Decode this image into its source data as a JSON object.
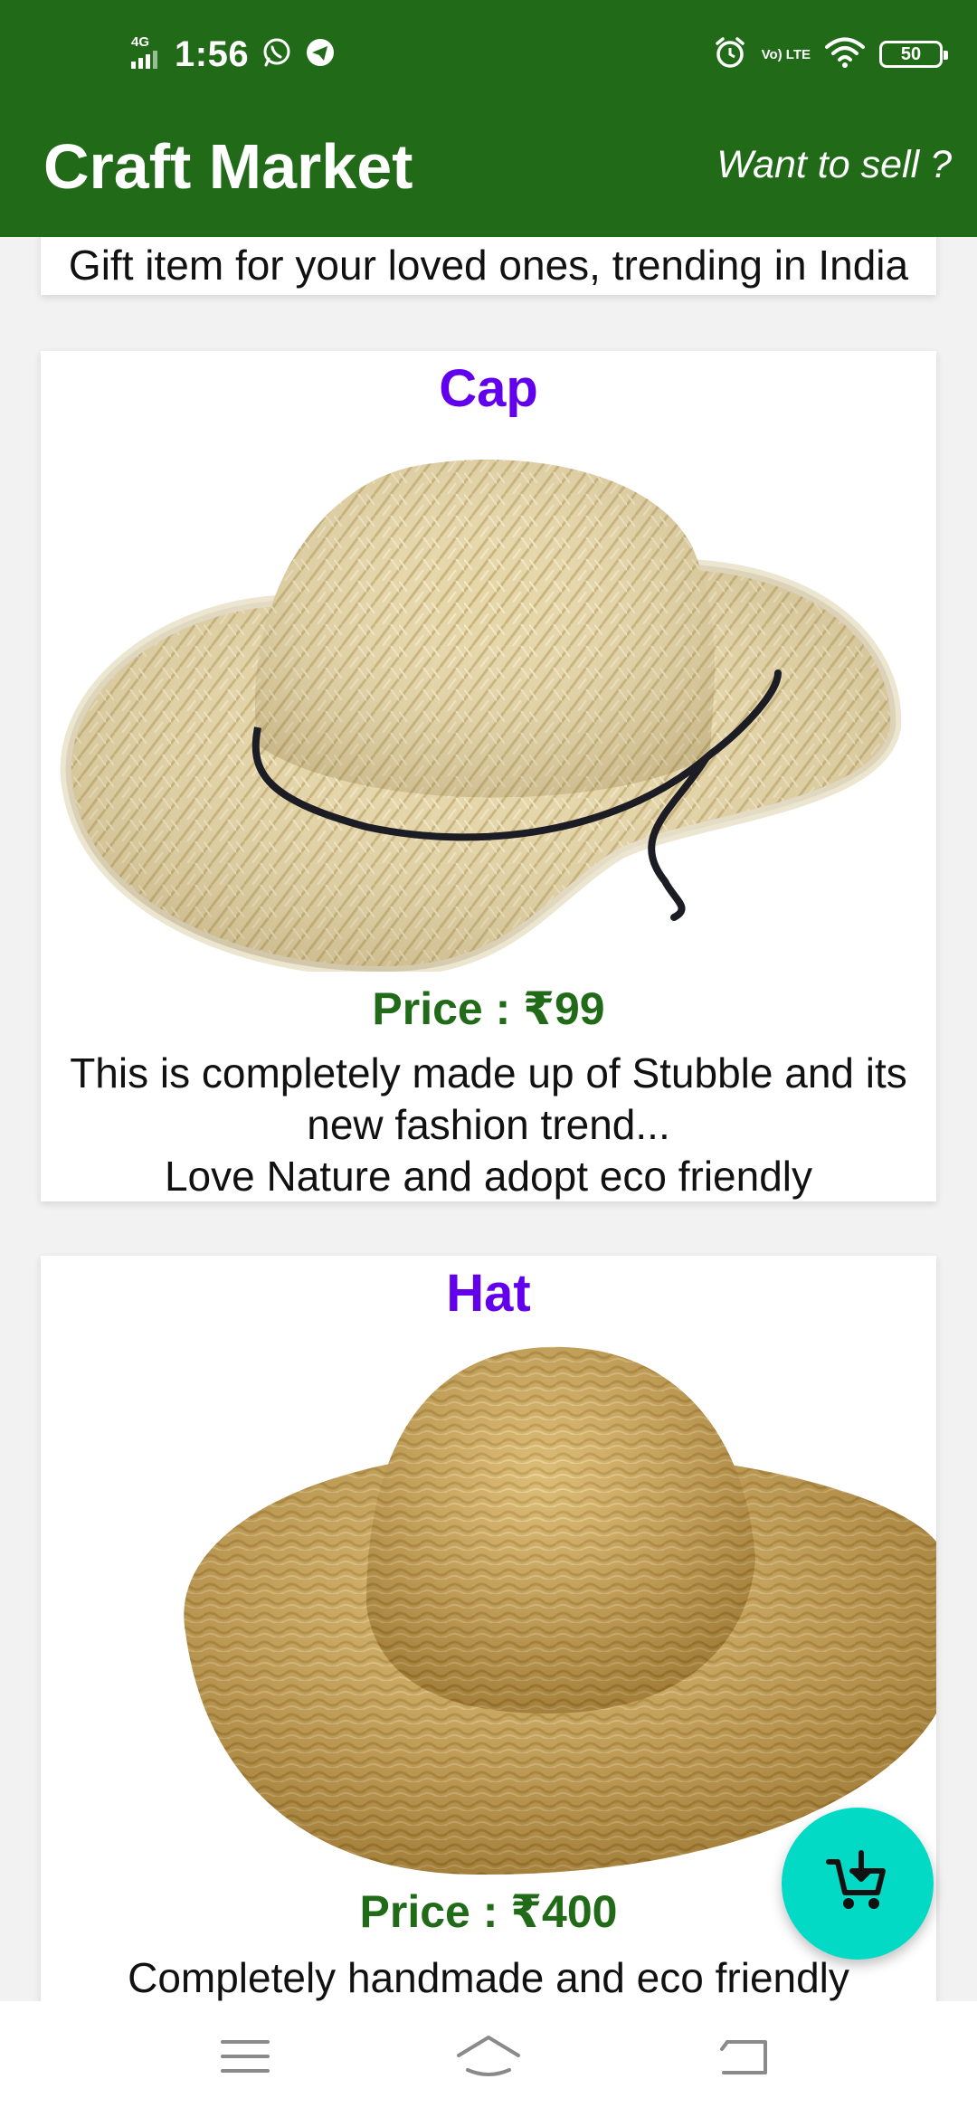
{
  "colors": {
    "brand": "#216b18",
    "title": "#6200ee",
    "price": "#216b18",
    "fab": "#03dac5"
  },
  "status_bar": {
    "network": "4G",
    "time": "1:56",
    "volte": "Vo) LTE",
    "battery": "50",
    "icons": [
      "signal-icon",
      "whatsapp-icon",
      "telegram-icon",
      "alarm-icon",
      "volte-icon",
      "wifi-icon",
      "battery-icon"
    ]
  },
  "app_bar": {
    "title": "Craft Market",
    "sell_link": "Want to sell ?"
  },
  "products": {
    "partial": {
      "description": "Gift item for your loved ones, trending in India"
    },
    "cap": {
      "title": "Cap",
      "price": "Price : ₹99",
      "description_line1": "This is completely made up of Stubble and its new fashion trend...",
      "description_line2": "Love Nature and adopt eco friendly",
      "image": "straw-cowboy-hat-image"
    },
    "hat": {
      "title": "Hat",
      "price": "Price : ₹400",
      "description": "Completely handmade and eco friendly",
      "image": "straw-sun-hat-image"
    }
  },
  "fab": {
    "icon": "add-to-cart-icon"
  },
  "nav_bar": {
    "icons": [
      "menu-icon",
      "home-icon",
      "back-icon"
    ]
  }
}
